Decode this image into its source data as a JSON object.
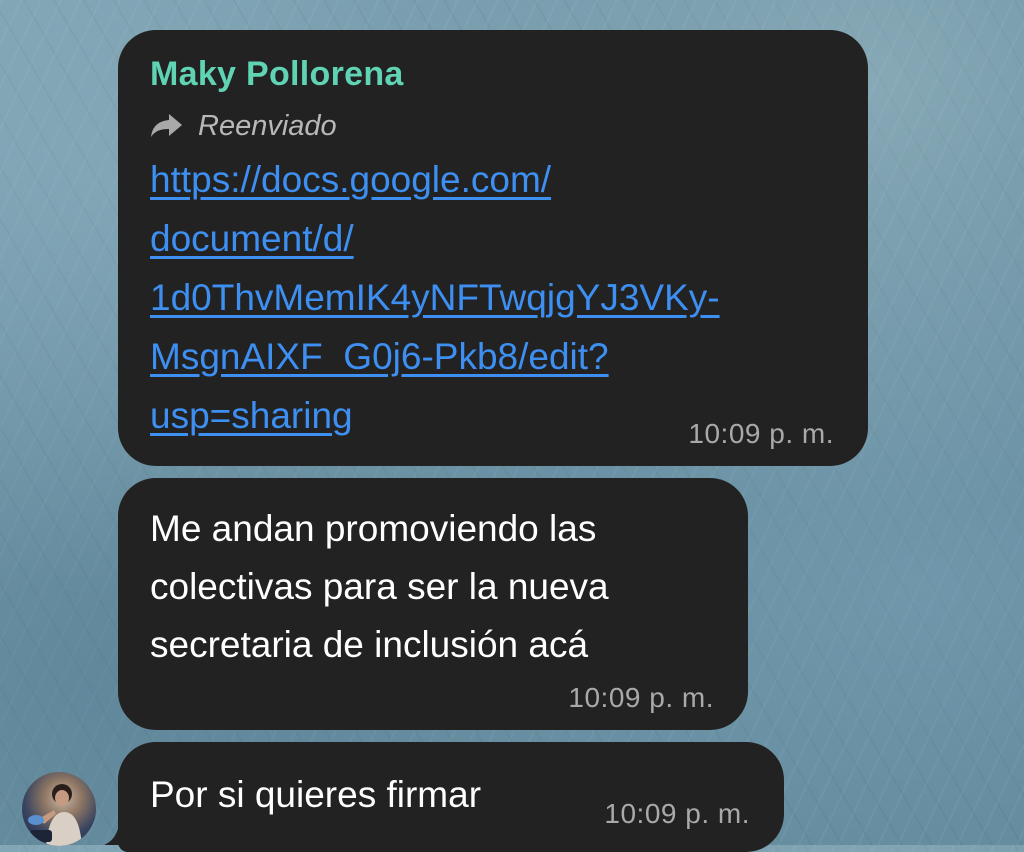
{
  "messages": [
    {
      "sender": "Maky Pollorena",
      "forwarded_label": "Reenviado",
      "link_lines": [
        "https://docs.google.com/",
        "document/d/",
        "1d0ThvMemIK4yNFTwqjgYJ3VKy-",
        "MsgnAIXF_G0j6-Pkb8/edit?",
        "usp=sharing"
      ],
      "time": "10:09 p. m."
    },
    {
      "text_lines": [
        "Me andan promoviendo las",
        "colectivas para ser la nueva",
        "secretaria de inclusión acá"
      ],
      "time": "10:09 p. m."
    },
    {
      "text_lines": [
        "Por si quieres firmar"
      ],
      "time": "10:09 p. m."
    }
  ],
  "icons": {
    "forward": "forward-arrow-icon",
    "avatar": "user-avatar"
  },
  "colors": {
    "bubble": "#222222",
    "sender_name": "#5fd3b4",
    "link": "#3d8ff2",
    "timestamp": "#a9a9a9"
  }
}
